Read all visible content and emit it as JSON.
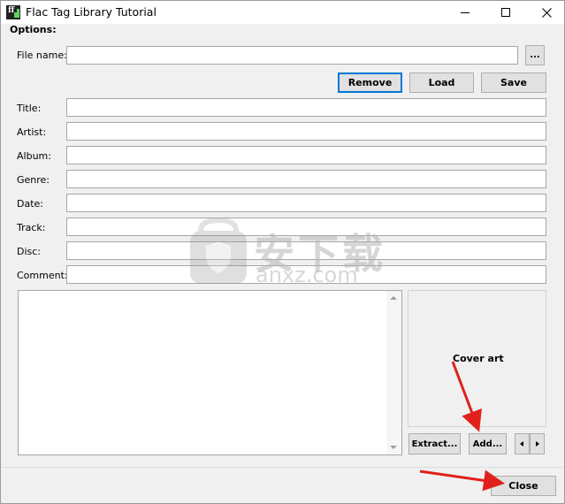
{
  "window": {
    "title": "Flac Tag Library Tutorial"
  },
  "options": {
    "heading": "Options:"
  },
  "file": {
    "label": "File name:",
    "value": "",
    "browse_label": "..."
  },
  "buttons": {
    "remove": "Remove",
    "load": "Load",
    "save": "Save",
    "extract": "Extract...",
    "add": "Add...",
    "close": "Close"
  },
  "tags": [
    {
      "label": "Title:",
      "value": ""
    },
    {
      "label": "Artist:",
      "value": ""
    },
    {
      "label": "Album:",
      "value": ""
    },
    {
      "label": "Genre:",
      "value": ""
    },
    {
      "label": "Date:",
      "value": ""
    },
    {
      "label": "Track:",
      "value": ""
    },
    {
      "label": "Disc:",
      "value": ""
    },
    {
      "label": "Comment:",
      "value": ""
    }
  ],
  "cover": {
    "label": "Cover art"
  },
  "watermark": {
    "text": "安下载",
    "subtext": "anxz.com"
  },
  "colors": {
    "default_button_border": "#0078d7",
    "annotation_arrow": "#e0201b"
  }
}
